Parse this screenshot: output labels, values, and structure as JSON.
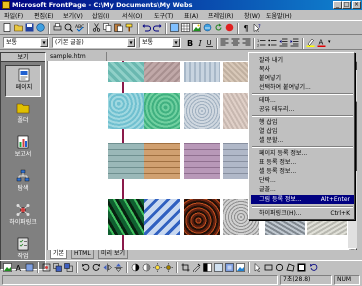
{
  "window": {
    "title": "Microsoft FrontPage - C:\\My Documents\\My Webs"
  },
  "menu": [
    "파일(F)",
    "편집(E)",
    "보기(V)",
    "삽입(I)",
    "서식(O)",
    "도구(T)",
    "표(A)",
    "프레임(R)",
    "창(W)",
    "도움말(H)"
  ],
  "formatting": {
    "style": "보통",
    "font": "(기본 글꼴)",
    "size": "보통"
  },
  "views_bar": {
    "header": "보기",
    "items": [
      {
        "label": "페이지",
        "icon": "page-view-icon",
        "color": "#2060d0"
      },
      {
        "label": "폴더",
        "icon": "folder-view-icon",
        "color": "#e0c000"
      },
      {
        "label": "보고서",
        "icon": "reports-view-icon",
        "color": "#20a040"
      },
      {
        "label": "탐색",
        "icon": "navigation-view-icon",
        "color": "#3070d0"
      },
      {
        "label": "하이퍼링크",
        "icon": "hyperlinks-view-icon",
        "color": "#d04040"
      },
      {
        "label": "작업",
        "icon": "tasks-view-icon",
        "color": "#e0e0e0"
      }
    ]
  },
  "document": {
    "tab_label": "sample.htm",
    "bottom_tabs": [
      "기본",
      "HTML",
      "미리 보기"
    ]
  },
  "context_menu": {
    "items": [
      {
        "label": "잘라 내기",
        "shortcut": ""
      },
      {
        "label": "복사",
        "shortcut": ""
      },
      {
        "label": "붙여넣기",
        "shortcut": ""
      },
      {
        "label": "선택하여 붙여넣기...",
        "shortcut": ""
      },
      {
        "sep": true
      },
      {
        "label": "테마...",
        "shortcut": ""
      },
      {
        "label": "공유 테두리...",
        "shortcut": ""
      },
      {
        "sep": true
      },
      {
        "label": "행 삽입",
        "shortcut": ""
      },
      {
        "label": "열 삽입",
        "shortcut": ""
      },
      {
        "label": "셀 분할...",
        "shortcut": ""
      },
      {
        "sep": true
      },
      {
        "label": "페이지 등록 정보...",
        "shortcut": ""
      },
      {
        "label": "표 등록 정보...",
        "shortcut": ""
      },
      {
        "label": "셀 등록 정보...",
        "shortcut": ""
      },
      {
        "label": "단락...",
        "shortcut": ""
      },
      {
        "label": "글꼴...",
        "shortcut": ""
      },
      {
        "label": "그림 등록 정보...",
        "shortcut": "Alt+Enter",
        "highlighted": true
      },
      {
        "sep": true
      },
      {
        "label": "하이퍼링크(H)...",
        "shortcut": "Ctrl+K"
      }
    ]
  },
  "status": {
    "time": "7초(28.8)",
    "mode": "NUM"
  },
  "colors": {
    "title_bar": "#000080",
    "menu_highlight": "#000080",
    "face": "#c0c0c0",
    "views_bg": "#808080",
    "doc_bg": "#ffffff",
    "margin_line": "#8a1a4a"
  }
}
